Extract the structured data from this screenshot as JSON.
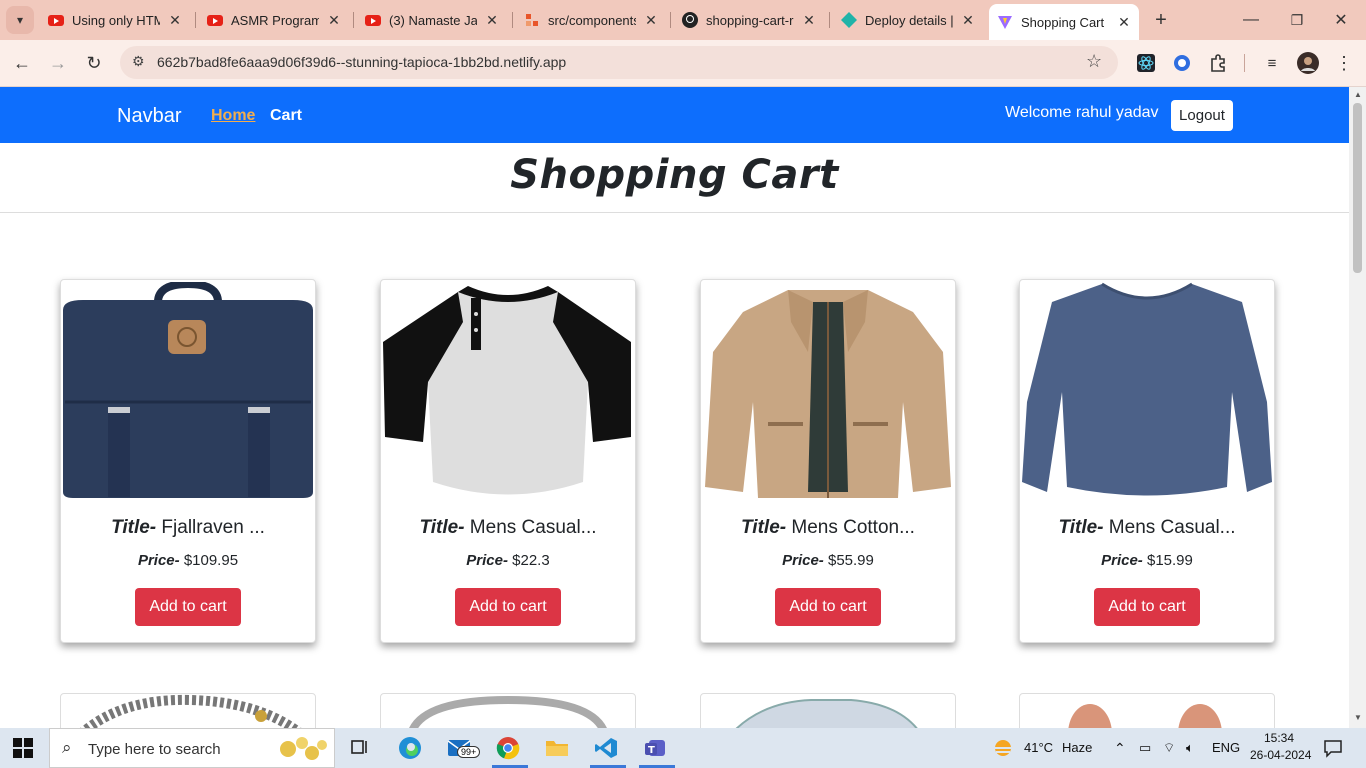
{
  "browser": {
    "tabs": [
      {
        "title": "Using only HTM",
        "icon": "youtube-icon"
      },
      {
        "title": "ASMR Program",
        "icon": "youtube-icon"
      },
      {
        "title": "(3) Namaste Jav",
        "icon": "youtube-icon"
      },
      {
        "title": "src/components",
        "icon": "code-icon"
      },
      {
        "title": "shopping-cart-r",
        "icon": "github-icon"
      },
      {
        "title": "Deploy details |",
        "icon": "netlify-icon"
      },
      {
        "title": "Shopping Cart",
        "icon": "vite-icon"
      }
    ],
    "url": "662b7bad8fe6aaa9d06f39d6--stunning-tapioca-1bb2bd.netlify.app"
  },
  "navbar": {
    "brand": "Navbar",
    "links": [
      {
        "label": "Home",
        "active": true
      },
      {
        "label": "Cart",
        "active": false
      }
    ],
    "welcome": "Welcome rahul yadav",
    "logout_label": "Logout"
  },
  "main": {
    "title": "Shopping Cart",
    "title_label": "Title-",
    "price_label": "Price-",
    "add_label": "Add to cart",
    "products": [
      {
        "title": "Fjallraven ...",
        "price": "$109.95",
        "image": "backpack"
      },
      {
        "title": "Mens Casual...",
        "price": "$22.3",
        "image": "raglan-tshirt"
      },
      {
        "title": "Mens Cotton...",
        "price": "$55.99",
        "image": "jacket"
      },
      {
        "title": "Mens Casual...",
        "price": "$15.99",
        "image": "long-sleeve-tshirt"
      }
    ]
  },
  "taskbar": {
    "search_placeholder": "Type here to search",
    "weather": "41°C",
    "weather_desc": "Haze",
    "lang": "ENG",
    "time": "15:34",
    "date": "26-04-2024",
    "mail_badge": "99+"
  },
  "colors": {
    "navbar": "#0d6efd",
    "active_link": "#f0ad4e",
    "add_button": "#dc3545",
    "tabstrip": "#f1c9bd"
  }
}
